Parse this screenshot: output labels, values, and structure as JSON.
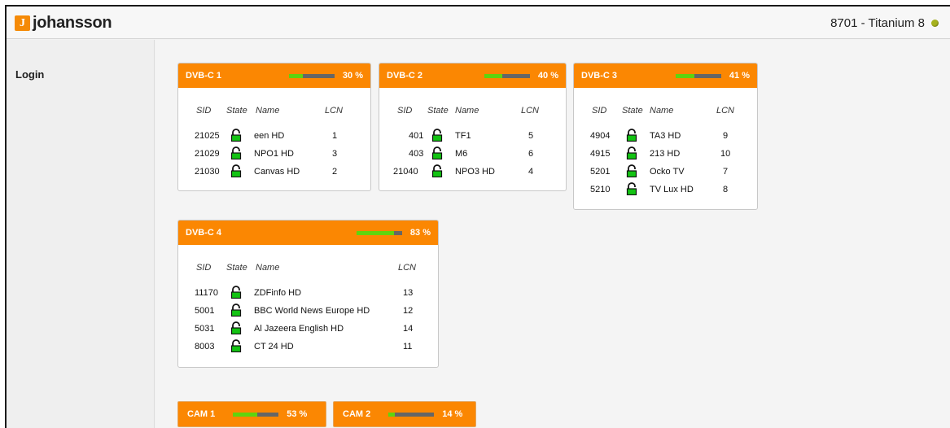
{
  "header": {
    "logo_letter": "J",
    "logo_text": "johansson",
    "device_name": "8701 - Titanium 8",
    "status_color": "#a6b21e"
  },
  "sidebar": {
    "login_label": "Login"
  },
  "columns": {
    "sid": "SID",
    "state": "State",
    "name": "Name",
    "lcn": "LCN"
  },
  "colors": {
    "accent": "#fb8702",
    "bar_fill": "#5fd40e",
    "bar_track": "#666666",
    "lock": "#13c313"
  },
  "tuners": [
    {
      "title": "DVB-C 1",
      "load_percent": 30,
      "load_label": "30 %",
      "services": [
        {
          "sid": "21025",
          "name": "een HD",
          "lcn": "1"
        },
        {
          "sid": "21029",
          "name": "NPO1 HD",
          "lcn": "3"
        },
        {
          "sid": "21030",
          "name": "Canvas HD",
          "lcn": "2"
        }
      ]
    },
    {
      "title": "DVB-C 2",
      "load_percent": 40,
      "load_label": "40 %",
      "services": [
        {
          "sid": "401",
          "name": "TF1",
          "lcn": "5"
        },
        {
          "sid": "403",
          "name": "M6",
          "lcn": "6"
        },
        {
          "sid": "21040",
          "name": "NPO3 HD",
          "lcn": "4"
        }
      ]
    },
    {
      "title": "DVB-C 3",
      "load_percent": 41,
      "load_label": "41 %",
      "services": [
        {
          "sid": "4904",
          "name": "TA3 HD",
          "lcn": "9"
        },
        {
          "sid": "4915",
          "name": "213 HD",
          "lcn": "10"
        },
        {
          "sid": "5201",
          "name": "Ocko TV",
          "lcn": "7"
        },
        {
          "sid": "5210",
          "name": "TV Lux HD",
          "lcn": "8"
        }
      ]
    },
    {
      "title": "DVB-C 4",
      "load_percent": 83,
      "load_label": "83 %",
      "services": [
        {
          "sid": "11170",
          "name": "ZDFinfo HD",
          "lcn": "13"
        },
        {
          "sid": "5001",
          "name": "BBC World News Europe HD",
          "lcn": "12"
        },
        {
          "sid": "5031",
          "name": "Al Jazeera English HD",
          "lcn": "14"
        },
        {
          "sid": "8003",
          "name": "CT 24 HD",
          "lcn": "11"
        }
      ]
    }
  ],
  "cams": [
    {
      "title": "CAM 1",
      "load_percent": 53,
      "load_label": "53 %"
    },
    {
      "title": "CAM 2",
      "load_percent": 14,
      "load_label": "14 %"
    }
  ]
}
